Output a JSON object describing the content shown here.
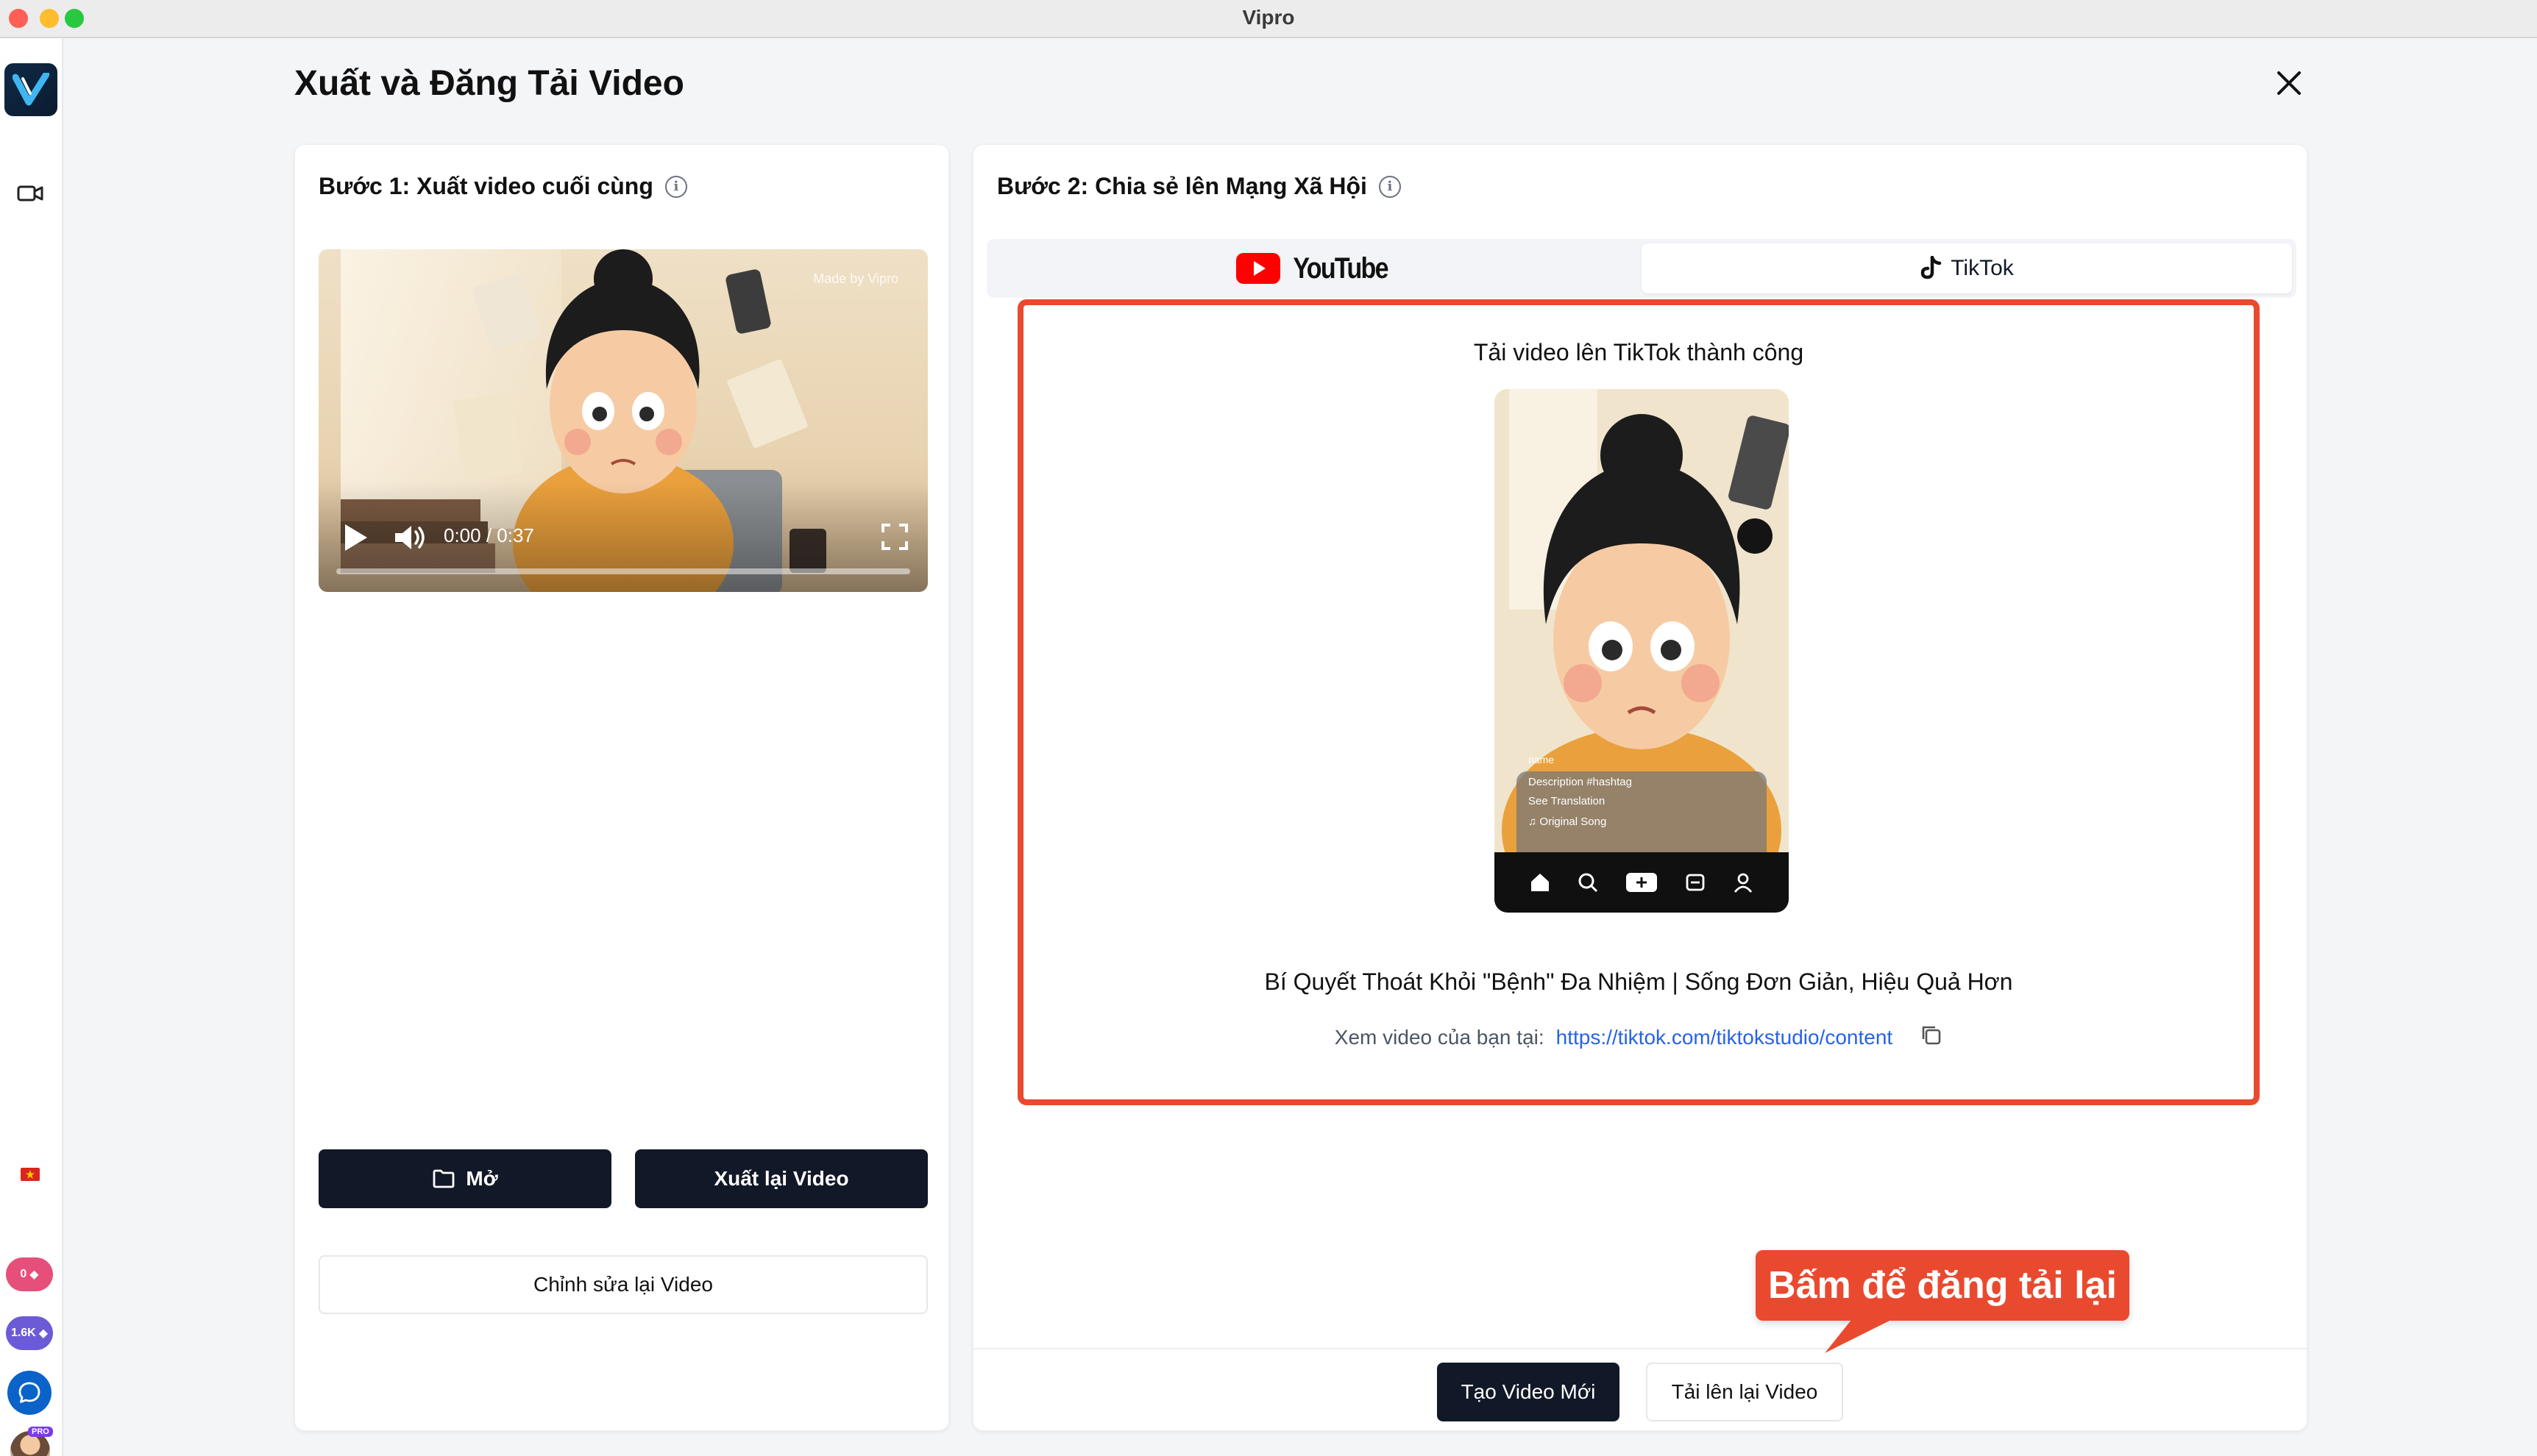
{
  "window": {
    "title": "Vipro"
  },
  "rail": {
    "pill_credits": "0",
    "pill_gems": "1.6K",
    "pro_badge": "PRO",
    "colors": {
      "pill_credits": "#e64f7a",
      "pill_gems": "#6b5bd6",
      "chat": "#0b63c9"
    }
  },
  "header": {
    "title": "Xuất và Đăng Tải Video"
  },
  "step1": {
    "heading": "Bước 1: Xuất video cuối cùng",
    "player": {
      "watermark": "Made by Vipro",
      "time": "0:00 / 0:37",
      "progress": 0
    },
    "open_label": "Mở",
    "reexport_label": "Xuất lại Video",
    "edit_label": "Chỉnh sửa lại Video"
  },
  "step2": {
    "heading": "Bước 2: Chia sẻ lên Mạng Xã Hội",
    "tabs": [
      {
        "label": "YouTube",
        "active": false
      },
      {
        "label": "TikTok",
        "active": true
      }
    ],
    "result": {
      "title": "Tải video lên TikTok thành công",
      "preview": {
        "username": "name",
        "description": "Description #hashtag",
        "translation": "See Translation",
        "song": "Original Song"
      },
      "video_title": "Bí Quyết Thoát Khỏi \"Bệnh\" Đa Nhiệm | Sống Đơn Giản, Hiệu Quả Hơn",
      "link_label": "Xem video của bạn tại:",
      "link_url": "https://tiktok.com/tiktokstudio/content"
    },
    "new_video_label": "Tạo Video Mới",
    "reupload_label": "Tải lên lại Video"
  },
  "callout": {
    "text": "Bấm để đăng tải lại",
    "color": "#e94a2f"
  },
  "colors": {
    "primary_button": "#111827",
    "link": "#2563eb",
    "youtube_red": "#ff0000"
  }
}
